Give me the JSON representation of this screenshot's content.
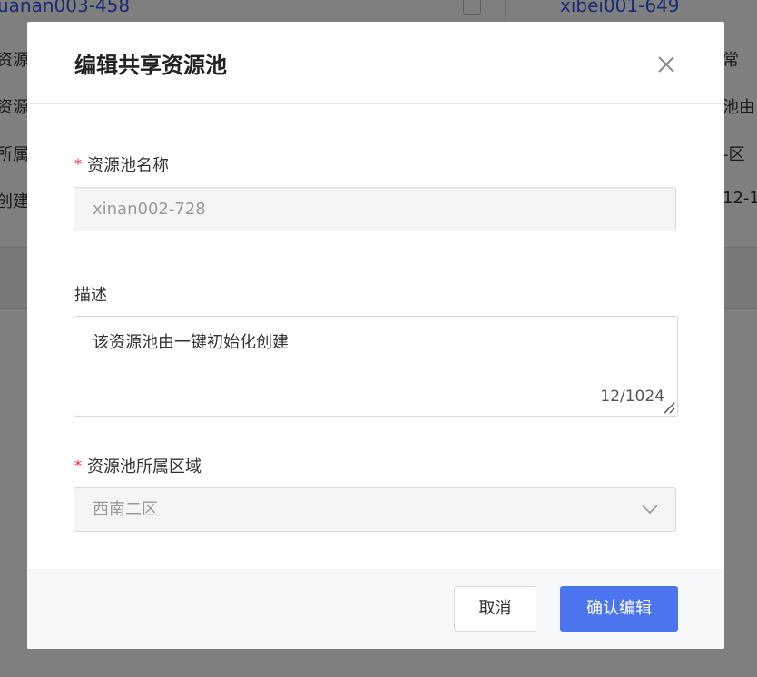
{
  "background": {
    "left_link": "uanan003-458",
    "right_link": "xibei001-649",
    "left_rows": [
      "资源池",
      "资源池",
      "所属区",
      "创建时"
    ],
    "right_rows": [
      "常",
      "池由",
      "-区",
      "12-1"
    ]
  },
  "modal": {
    "title": "编辑共享资源池",
    "close_icon": "close-icon",
    "fields": {
      "name": {
        "required_mark": "*",
        "label": "资源池名称",
        "value": "xinan002-728"
      },
      "description": {
        "label": "描述",
        "value": "该资源池由一键初始化创建",
        "counter": "12/1024"
      },
      "region": {
        "required_mark": "*",
        "label": "资源池所属区域",
        "value": "西南二区",
        "icon": "chevron-down-icon"
      }
    },
    "footer": {
      "cancel_label": "取消",
      "confirm_label": "确认编辑"
    }
  },
  "colors": {
    "primary": "#4c74ef",
    "required": "#f5222d",
    "overlay": "rgba(0,0,0,0.5)"
  }
}
